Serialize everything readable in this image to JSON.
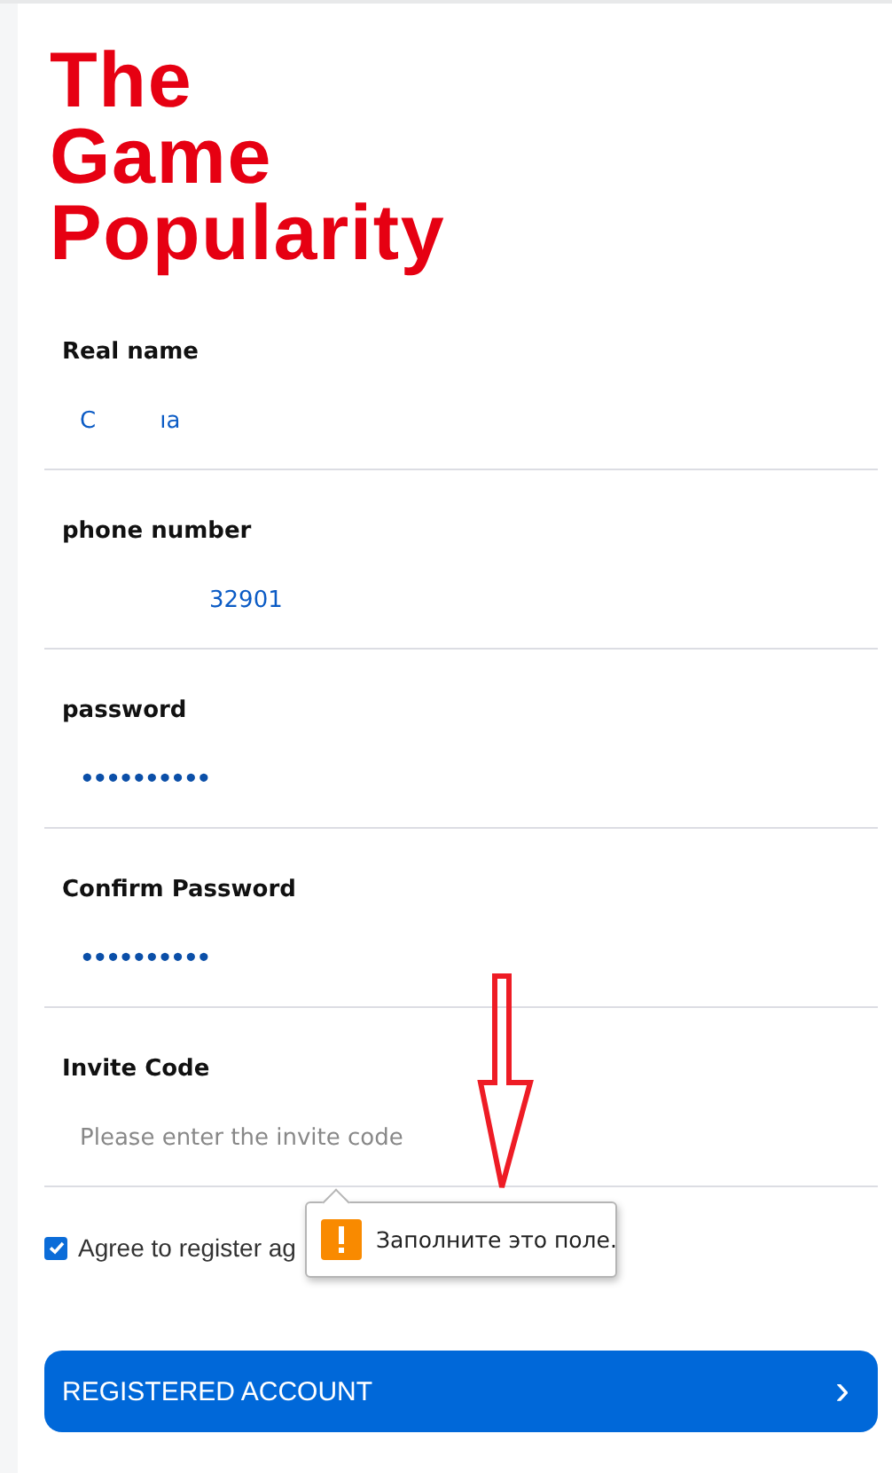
{
  "logo": {
    "lines": [
      "The",
      "Game",
      "Popularity"
    ]
  },
  "fields": [
    {
      "kind": "text",
      "label": "Real name",
      "value_parts": [
        "C",
        "ıa"
      ]
    },
    {
      "kind": "text",
      "label": "phone number",
      "value_parts": [
        "32901"
      ]
    },
    {
      "kind": "password",
      "label": "password",
      "value": "••••••••••"
    },
    {
      "kind": "password",
      "label": "Confirm Password",
      "value": "••••••••••"
    },
    {
      "kind": "empty",
      "label": "Invite Code",
      "placeholder": "Please enter the invite code"
    }
  ],
  "agreement": {
    "checked": true,
    "label": "Agree to register ag"
  },
  "validation_tooltip": {
    "message": "Заполните это поле."
  },
  "submit_button": {
    "label": "REGISTERED ACCOUNT",
    "icon": "›"
  }
}
